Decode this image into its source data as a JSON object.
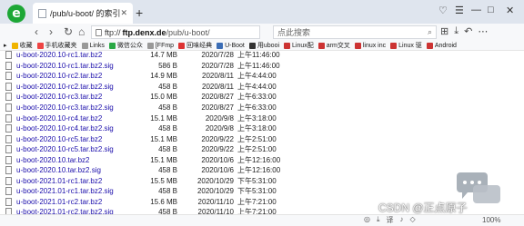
{
  "browser": {
    "tab_title": "/pub/u-boot/ 的索引",
    "address": {
      "prefix": "ftp://",
      "host": "ftp.denx.de",
      "path": "/pub/u-boot/"
    },
    "search_placeholder": "点此搜索",
    "bookmarks": [
      {
        "label": "收藏",
        "color": "#f0b400"
      },
      {
        "label": "手机收藏夹",
        "color": "#e44"
      },
      {
        "label": "Links",
        "color": "#999"
      },
      {
        "label": "微信公众",
        "color": "#2aa845"
      },
      {
        "label": "[FFmp",
        "color": "#999"
      },
      {
        "label": "回味经典",
        "color": "#d33"
      },
      {
        "label": "U-Boot",
        "color": "#3b6db5"
      },
      {
        "label": "用ubooi",
        "color": "#333"
      },
      {
        "label": "Linux配",
        "color": "#c33"
      },
      {
        "label": "arm交叉",
        "color": "#c33"
      },
      {
        "label": "linux inc",
        "color": "#c33"
      },
      {
        "label": "Linux 驱",
        "color": "#c33"
      },
      {
        "label": "Android",
        "color": "#c33"
      }
    ],
    "zoom": "100%"
  },
  "listing": {
    "rows": [
      {
        "name": "u-boot-2020.10-rc1.tar.bz2",
        "size": "14.7 MB",
        "date": "2020/7/28",
        "time": "上午11:46:00"
      },
      {
        "name": "u-boot-2020.10-rc1.tar.bz2.sig",
        "size": "586 B",
        "date": "2020/7/28",
        "time": "上午11:46:00"
      },
      {
        "name": "u-boot-2020.10-rc2.tar.bz2",
        "size": "14.9 MB",
        "date": "2020/8/11",
        "time": "上午4:44:00"
      },
      {
        "name": "u-boot-2020.10-rc2.tar.bz2.sig",
        "size": "458 B",
        "date": "2020/8/11",
        "time": "上午4:44:00"
      },
      {
        "name": "u-boot-2020.10-rc3.tar.bz2",
        "size": "15.0 MB",
        "date": "2020/8/27",
        "time": "上午6:33:00"
      },
      {
        "name": "u-boot-2020.10-rc3.tar.bz2.sig",
        "size": "458 B",
        "date": "2020/8/27",
        "time": "上午6:33:00"
      },
      {
        "name": "u-boot-2020.10-rc4.tar.bz2",
        "size": "15.1 MB",
        "date": "2020/9/8",
        "time": "上午3:18:00"
      },
      {
        "name": "u-boot-2020.10-rc4.tar.bz2.sig",
        "size": "458 B",
        "date": "2020/9/8",
        "time": "上午3:18:00"
      },
      {
        "name": "u-boot-2020.10-rc5.tar.bz2",
        "size": "15.1 MB",
        "date": "2020/9/22",
        "time": "上午2:51:00"
      },
      {
        "name": "u-boot-2020.10-rc5.tar.bz2.sig",
        "size": "458 B",
        "date": "2020/9/22",
        "time": "上午2:51:00"
      },
      {
        "name": "u-boot-2020.10.tar.bz2",
        "size": "15.1 MB",
        "date": "2020/10/6",
        "time": "上午12:16:00"
      },
      {
        "name": "u-boot-2020.10.tar.bz2.sig",
        "size": "458 B",
        "date": "2020/10/6",
        "time": "上午12:16:00"
      },
      {
        "name": "u-boot-2021.01-rc1.tar.bz2",
        "size": "15.5 MB",
        "date": "2020/10/29",
        "time": "下午5:31:00"
      },
      {
        "name": "u-boot-2021.01-rc1.tar.bz2.sig",
        "size": "458 B",
        "date": "2020/10/29",
        "time": "下午5:31:00"
      },
      {
        "name": "u-boot-2021.01-rc2.tar.bz2",
        "size": "15.6 MB",
        "date": "2020/11/10",
        "time": "上午7:21:00"
      },
      {
        "name": "u-boot-2021.01-rc2.tar.bz2.sig",
        "size": "458 B",
        "date": "2020/11/10",
        "time": "上午7:21:00"
      }
    ]
  },
  "overlay": {
    "watermark": "CSDN @正点原子"
  },
  "icons": {
    "logo": "browser-logo",
    "back": "back-arrow-icon",
    "forward": "forward-arrow-icon",
    "refresh": "refresh-icon",
    "home": "home-icon"
  }
}
